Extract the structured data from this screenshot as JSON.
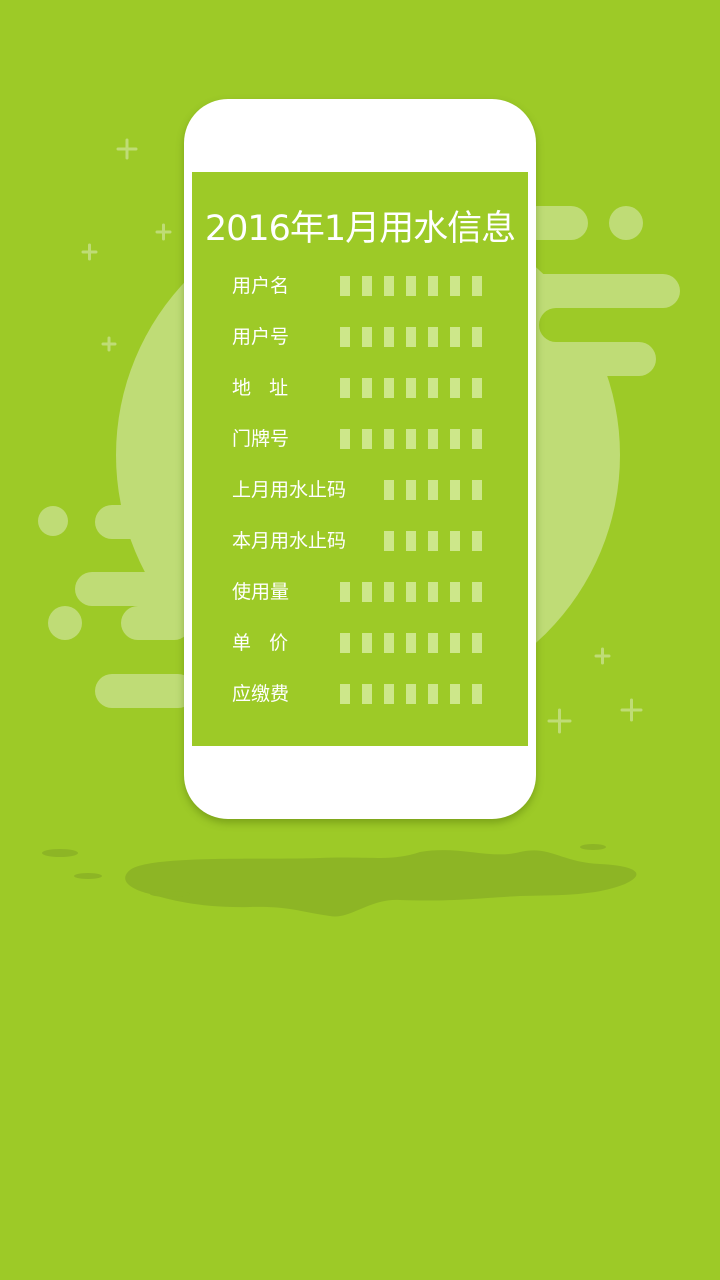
{
  "colors": {
    "background": "#9dca27",
    "phone_body": "#ffffff",
    "decor_light": "#bfdc76",
    "shadow_dark": "#8db525",
    "mask_bars": "#cde78a",
    "text": "#ffffff"
  },
  "card": {
    "title": "2016年1月用水信息",
    "rows": [
      {
        "label": "用户名",
        "masked_chars": 7
      },
      {
        "label": "用户号",
        "masked_chars": 7
      },
      {
        "label": "地   址",
        "masked_chars": 7
      },
      {
        "label": "门牌号",
        "masked_chars": 7
      },
      {
        "label": "上月用水止码",
        "masked_chars": 5
      },
      {
        "label": "本月用水止码",
        "masked_chars": 5
      },
      {
        "label": "使用量",
        "masked_chars": 7
      },
      {
        "label": "单   价",
        "masked_chars": 7
      },
      {
        "label": "应缴费",
        "masked_chars": 7
      }
    ]
  },
  "decorations": [
    "plus-sparkle-icon",
    "bubble-circle",
    "pill-shape",
    "puddle-shadow"
  ]
}
